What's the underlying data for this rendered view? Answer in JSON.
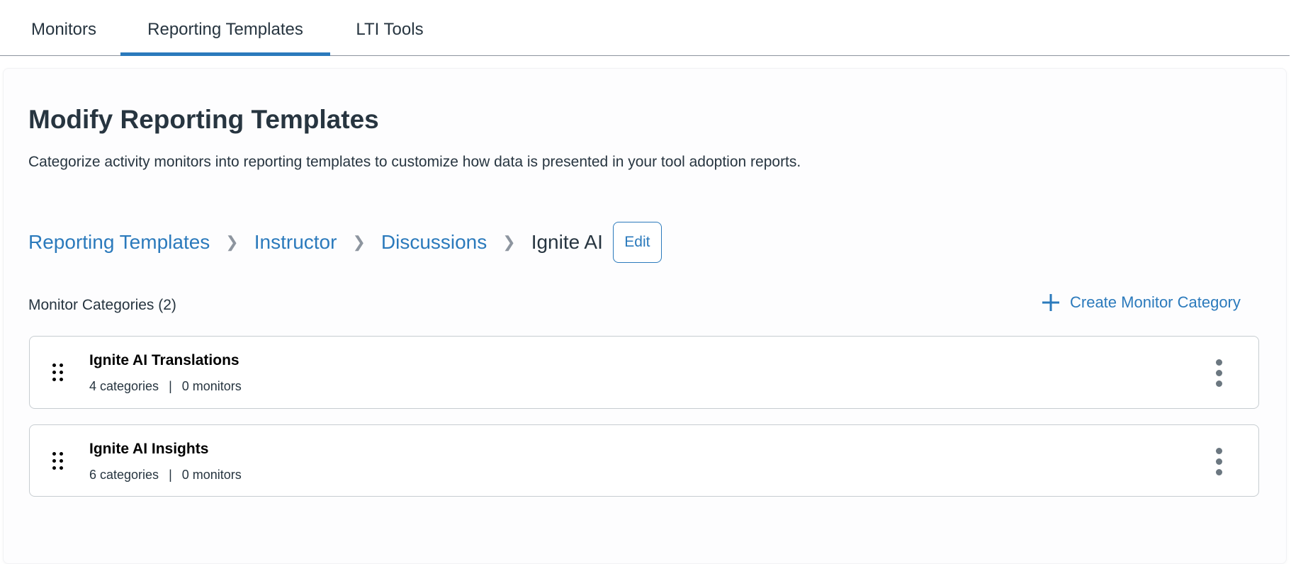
{
  "tabs": [
    {
      "label": "Monitors"
    },
    {
      "label": "Reporting Templates",
      "active": true
    },
    {
      "label": "LTI Tools"
    }
  ],
  "page": {
    "title": "Modify Reporting Templates",
    "description": "Categorize activity monitors into reporting templates to customize how data is presented in your tool adoption reports."
  },
  "breadcrumb": {
    "items": [
      "Reporting Templates",
      "Instructor",
      "Discussions"
    ],
    "current": "Ignite AI",
    "edit_label": "Edit"
  },
  "categories": {
    "heading": "Monitor Categories (2)",
    "create_label": "Create Monitor Category",
    "items": [
      {
        "title": "Ignite AI Translations",
        "categories": "4 categories",
        "separator": "|",
        "monitors": "0 monitors"
      },
      {
        "title": "Ignite AI Insights",
        "categories": "6 categories",
        "separator": "|",
        "monitors": "0 monitors"
      }
    ]
  },
  "colors": {
    "accent": "#2b7abc",
    "text": "#273540"
  }
}
